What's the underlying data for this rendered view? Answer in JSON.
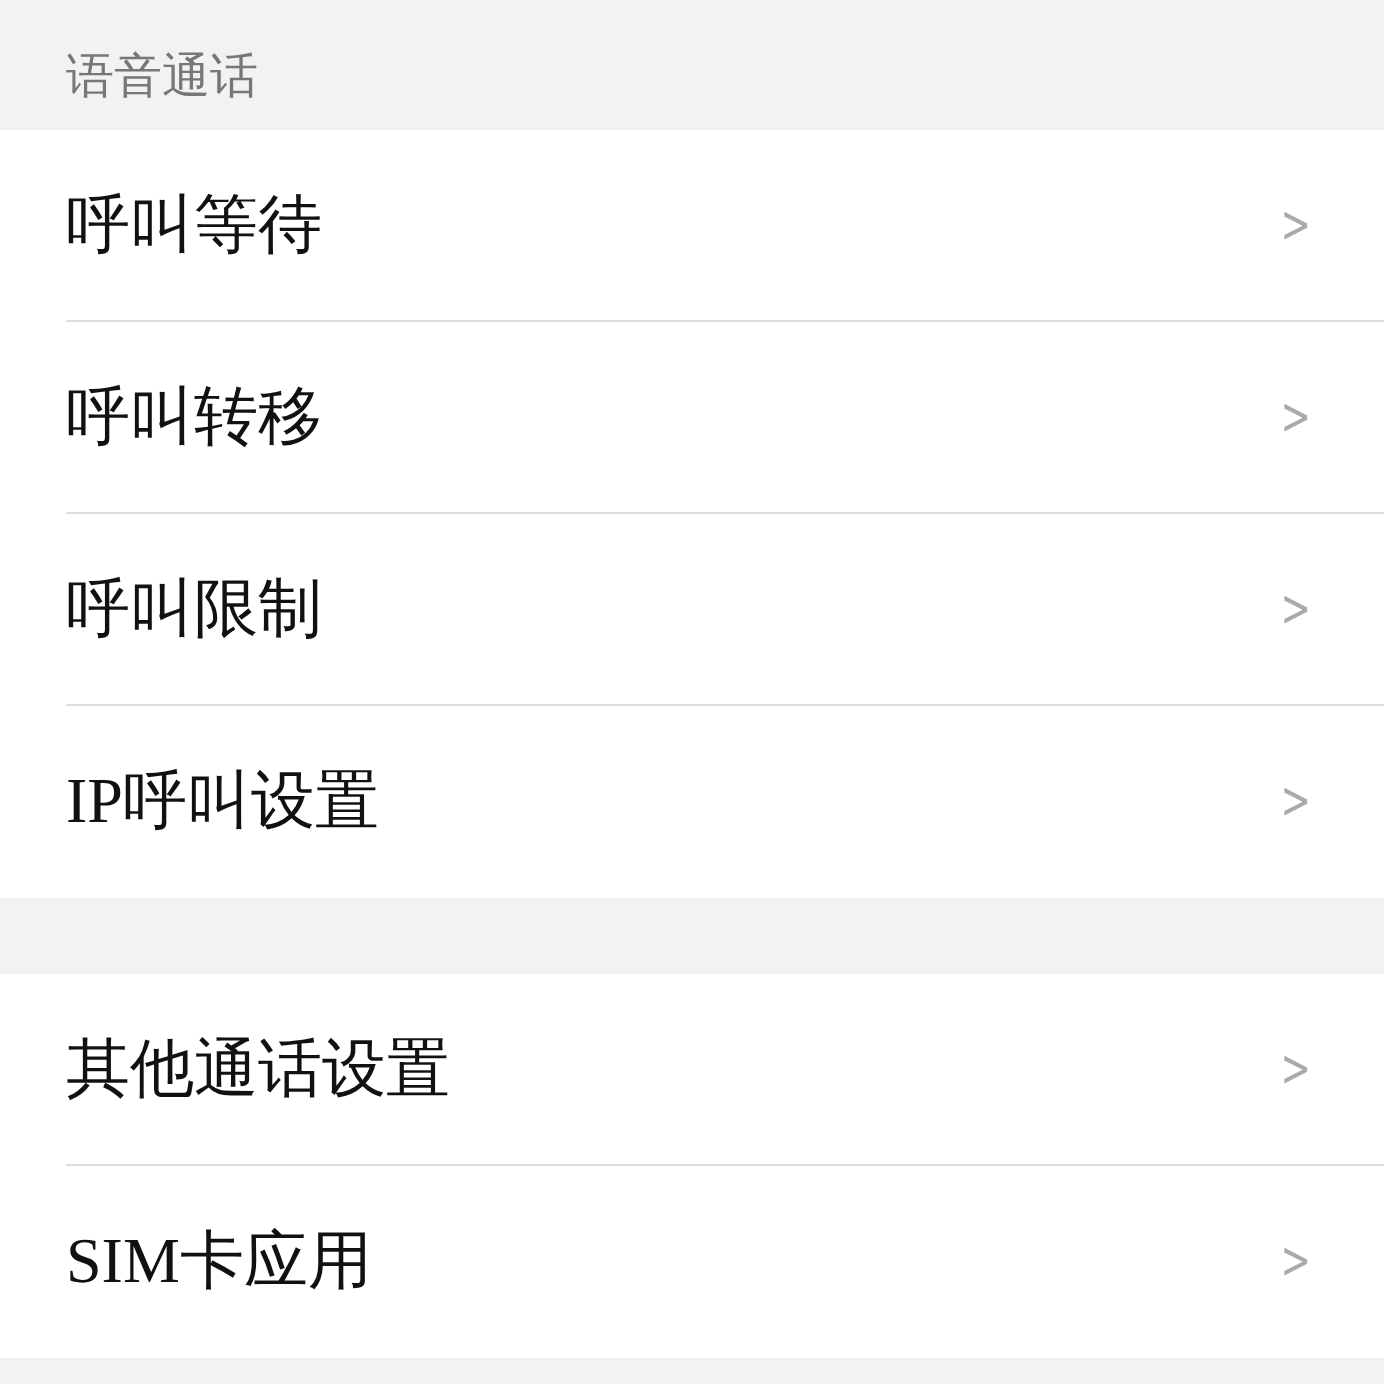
{
  "section_header": "语音通话",
  "groups": [
    {
      "items": [
        {
          "label": "呼叫等待",
          "chevron": ">"
        },
        {
          "label": "呼叫转移",
          "chevron": ">"
        },
        {
          "label": "呼叫限制",
          "chevron": ">"
        },
        {
          "label": "IP呼叫设置",
          "chevron": ">"
        }
      ]
    },
    {
      "items": [
        {
          "label": "其他通话设置",
          "chevron": ">"
        },
        {
          "label": "SIM卡应用",
          "chevron": ">"
        }
      ]
    }
  ]
}
